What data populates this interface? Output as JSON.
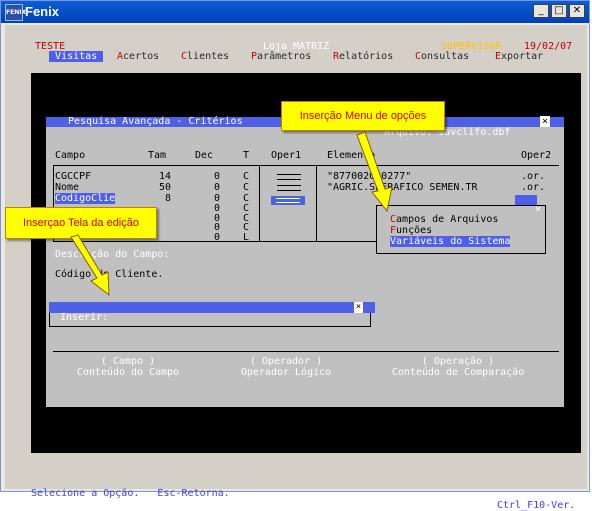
{
  "window": {
    "title": "Fenix",
    "icon_label": "FENIX",
    "minimize_glyph": "_",
    "maximize_glyph": "□",
    "close_glyph": "✕"
  },
  "header": {
    "company": "TESTE",
    "store": "Loja MATRIZ",
    "user": "SUPERVISOR",
    "date": "19/02/07"
  },
  "menu": [
    {
      "hotkey": "V",
      "rest": "isitas",
      "active": true
    },
    {
      "hotkey": "A",
      "rest": "certos"
    },
    {
      "hotkey": "C",
      "rest": "lientes"
    },
    {
      "hotkey": "P",
      "rest": "arâmetros"
    },
    {
      "hotkey": "R",
      "rest": "elatórios"
    },
    {
      "hotkey": "C",
      "rest": "onsultas"
    },
    {
      "hotkey": "E",
      "rest": "xportar"
    }
  ],
  "dialog": {
    "title": "Pesquisa Avançada - Critérios",
    "close_glyph": "×",
    "arquivo": "Arquivo: savclifo.dbf",
    "columns": [
      "Campo",
      "Tam",
      "Dec",
      "T",
      "Oper1",
      "Elemento",
      "Oper2"
    ],
    "rows": [
      {
        "campo": "CGCCPF",
        "tam": "14",
        "dec": "0",
        "t": "C",
        "elemento": "\"877002000277\"",
        "oper2": ".or."
      },
      {
        "campo": "Nome",
        "tam": "50",
        "dec": "0",
        "t": "C",
        "elemento": "\"AGRIC.SPERAFICO SEMEN.TR",
        "oper2": ".or."
      },
      {
        "campo": "CodigoClie",
        "tam": "8",
        "dec": "0",
        "t": "C",
        "elemento": "",
        "oper2": ""
      },
      {
        "campo": "",
        "tam": "",
        "dec": "0",
        "t": "C",
        "elemento": "",
        "oper2": ""
      },
      {
        "campo": "",
        "tam": "",
        "dec": "0",
        "t": "C",
        "elemento": "",
        "oper2": ""
      },
      {
        "campo": "",
        "tam": "",
        "dec": "0",
        "t": "C",
        "elemento": "",
        "oper2": ""
      },
      {
        "campo": "",
        "tam": "",
        "dec": "0",
        "t": "L",
        "elemento": "",
        "oper2": ""
      }
    ],
    "descricao_label": "Descrição do Campo:",
    "descricao_value": "Código do Cliente.",
    "inserir_label": " Inserir:",
    "edit_close_glyph": "×",
    "footer": [
      {
        "title": "( Campo )",
        "subtitle": "Conteúdo do Campo"
      },
      {
        "title": "( Operador )",
        "subtitle": "Operador Lógico"
      },
      {
        "title": "( Operação )",
        "subtitle": "Conteúdo de Comparação"
      }
    ]
  },
  "popup": {
    "close_glyph": "×",
    "items": [
      {
        "hotkey": "C",
        "rest": "ampos de Arquivos"
      },
      {
        "hotkey": "F",
        "rest": "unções"
      },
      {
        "hotkey": "V",
        "rest": "ariáveis do Sistema",
        "selected": true
      }
    ]
  },
  "status": {
    "hint": "Selecione a Opção.   Esc-Retorna.",
    "shortcut": "Ctrl_F10-Ver."
  },
  "callouts": {
    "menu": "Inserção Menu de opções",
    "edit": "Inserçao Tela da edição"
  }
}
